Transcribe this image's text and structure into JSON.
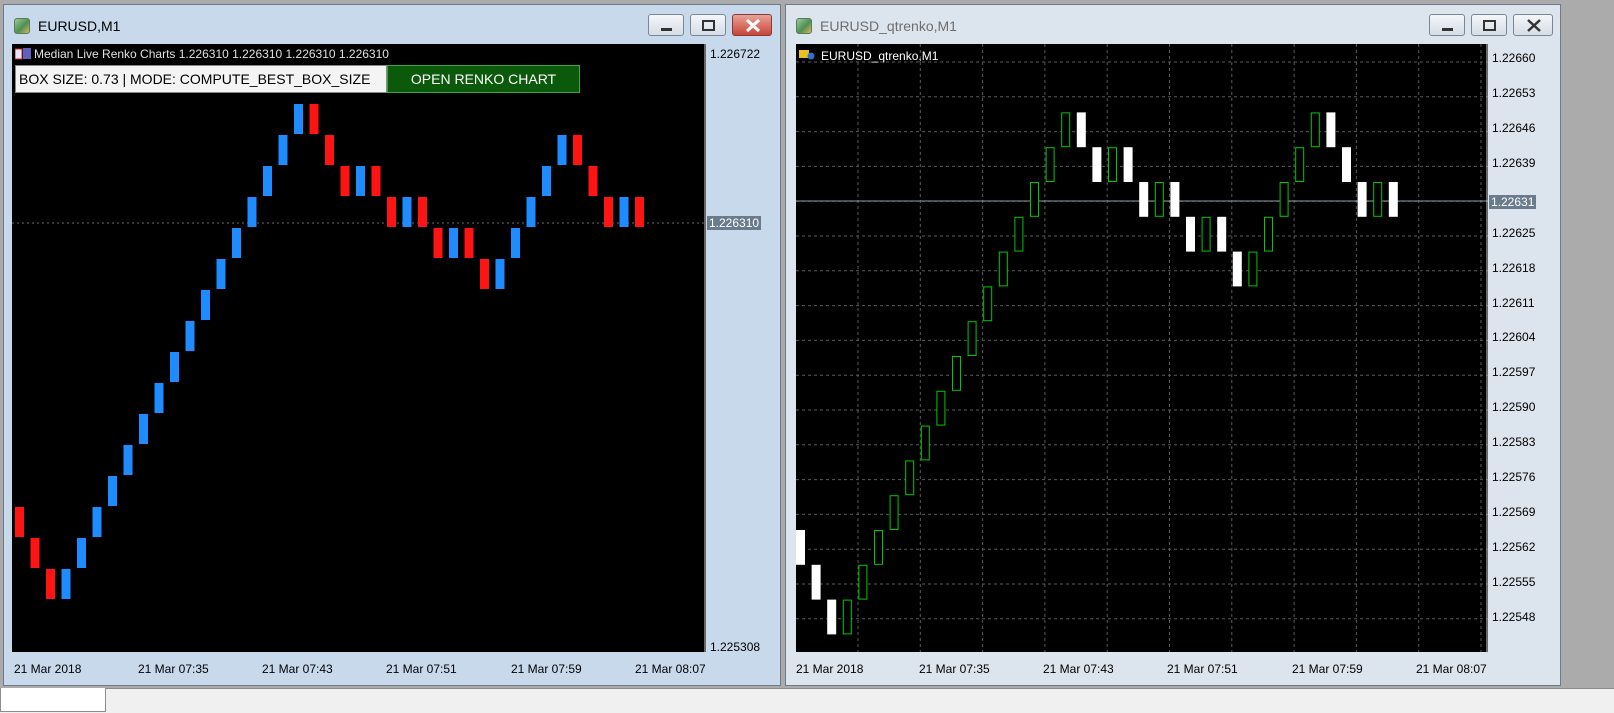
{
  "left_window": {
    "title": "EURUSD,M1",
    "overlay_title": "Median Live Renko Charts 1.226310 1.226310 1.226310 1.226310",
    "box_info": "BOX SIZE: 0.73 | MODE: COMPUTE_BEST_BOX_SIZE",
    "open_button_label": "OPEN RENKO CHART",
    "price_top": "1.226722",
    "price_bottom": "1.225308",
    "current_price": "1.226310",
    "time_labels": [
      "21 Mar 2018",
      "21 Mar 07:35",
      "21 Mar 07:43",
      "21 Mar 07:51",
      "21 Mar 07:59",
      "21 Mar 08:07"
    ],
    "colors": {
      "up": "#1E8CFF",
      "down": "#FF1414",
      "background": "#000000"
    }
  },
  "right_window": {
    "title": "EURUSD_qtrenko,M1",
    "overlay_title": "EURUSD_qtrenko,M1",
    "price_labels": [
      "1.22660",
      "1.22653",
      "1.22646",
      "1.22639",
      "1.22625",
      "1.22618",
      "1.22611",
      "1.22604",
      "1.22597",
      "1.22590",
      "1.22583",
      "1.22576",
      "1.22569",
      "1.22562",
      "1.22555",
      "1.22548"
    ],
    "current_price": "1.22631",
    "time_labels": [
      "21 Mar 2018",
      "21 Mar 07:35",
      "21 Mar 07:43",
      "21 Mar 07:51",
      "21 Mar 07:59",
      "21 Mar 08:07"
    ],
    "colors": {
      "up": "#00C800",
      "down": "#FFFFFF",
      "grid": "#5A5A5A",
      "background": "#000000"
    }
  },
  "chart_data": [
    {
      "type": "renko",
      "source": "EURUSD,M1",
      "brick_directions": [
        "down",
        "down",
        "down",
        "up",
        "up",
        "up",
        "up",
        "up",
        "up",
        "up",
        "up",
        "up",
        "up",
        "up",
        "up",
        "up",
        "up",
        "up",
        "up",
        "down",
        "down",
        "down",
        "up",
        "down",
        "down",
        "up",
        "down",
        "down",
        "up",
        "down",
        "down",
        "up",
        "up",
        "up",
        "up",
        "up",
        "down",
        "down",
        "down",
        "up",
        "down"
      ],
      "ylim": [
        1.225308,
        1.226722
      ]
    },
    {
      "type": "renko",
      "source": "EURUSD_qtrenko,M1",
      "brick_directions": [
        "down",
        "down",
        "down",
        "up",
        "up",
        "up",
        "up",
        "up",
        "up",
        "up",
        "up",
        "up",
        "up",
        "up",
        "up",
        "up",
        "up",
        "up",
        "down",
        "down",
        "up",
        "down",
        "down",
        "up",
        "down",
        "down",
        "up",
        "down",
        "down",
        "up",
        "up",
        "up",
        "up",
        "up",
        "down",
        "down",
        "down",
        "up",
        "down"
      ],
      "ylim": [
        1.22541,
        1.22663
      ]
    }
  ]
}
